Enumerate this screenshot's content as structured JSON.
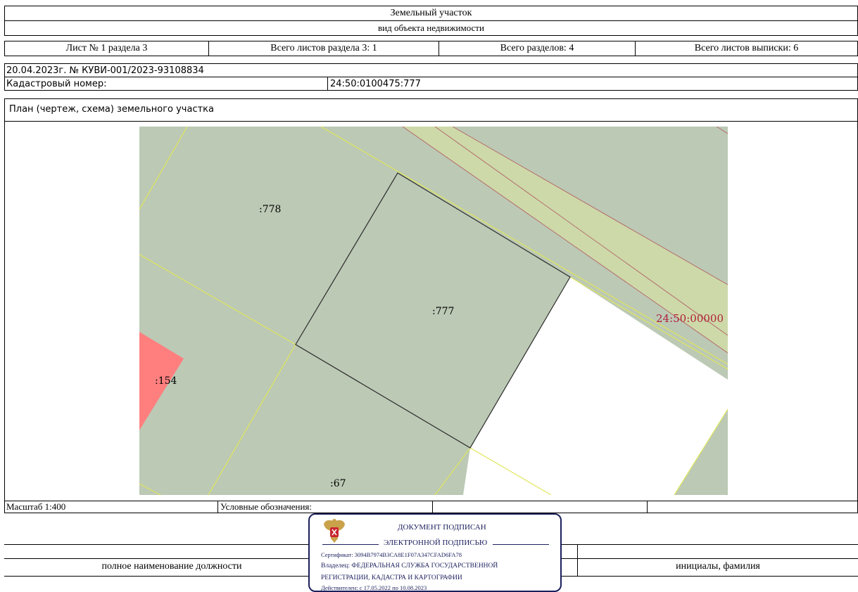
{
  "header": {
    "object_title": "Земельный участок",
    "object_subtitle": "вид объекта недвижимости",
    "sheet": "Лист № 1 раздела 3",
    "sheets_section": "Всего листов раздела 3: 1",
    "sections_total": "Всего разделов: 4",
    "sheets_total": "Всего листов выписки: 6"
  },
  "doc": {
    "date_number": "20.04.2023г. № КУВИ-001/2023-93108834",
    "cadastral_label": "Кадастровый номер:",
    "cadastral_value": "24:50:0100475:777"
  },
  "plan": {
    "title": "План (чертеж, схема) земельного участка",
    "labels": {
      "p778": ":778",
      "p777": ":777",
      "p154": ":154",
      "p67": ":67",
      "quarter": "24:50:00000"
    }
  },
  "footer": {
    "scale": "Масштаб 1:400",
    "legend_label": "Условные обозначения:",
    "position_label": "полное наименование должности",
    "name_label": "инициалы, фамилия"
  },
  "stamp": {
    "line1": "ДОКУМЕНТ ПОДПИСАН",
    "line2": "ЭЛЕКТРОННОЙ ПОДПИСЬЮ",
    "certificate": "Сертификат: 3094B7974B3CA8E1F07A347CFAD6FA78",
    "owner": "Владелец: ФЕДЕРАЛЬНАЯ СЛУЖБА ГОСУДАРСТВЕННОЙ",
    "owner2": "РЕГИСТРАЦИИ, КАДАСТРА И КАРТОГРАФИИ",
    "valid": "Действителен: с 17.05.2022 по 10.08.2023"
  },
  "colors": {
    "parcel_fill": "#bcc9b5",
    "road_fill": "#cdd9a9",
    "boundary_yellow": "#dfe65a",
    "highlight_red": "#ff7f7f",
    "quarter_text": "#b0203a",
    "stamp_border": "#1a1f5c"
  }
}
